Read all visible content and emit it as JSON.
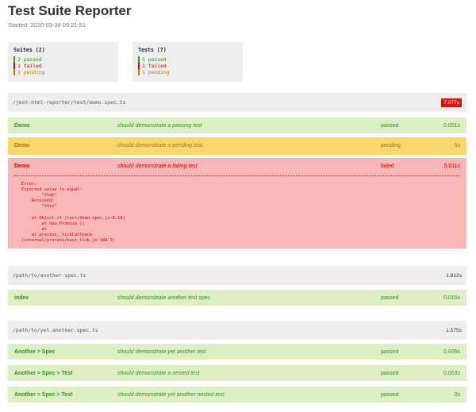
{
  "title": "Test Suite Reporter",
  "started": "Started: 2020-03-30 09:21:51",
  "summary": {
    "suites": {
      "title": "Suites (2)",
      "passed": "2 passed",
      "failed": "1 failed",
      "pending": "1 pending"
    },
    "tests": {
      "title": "Tests (7)",
      "passed": "5 passed",
      "failed": "1 failed",
      "pending": "1 pending"
    }
  },
  "colors": {
    "passed": "#3a8e1e",
    "failed": "#cc0000",
    "pending": "#c07a00",
    "slow_badge": "#d9150a"
  },
  "suites": [
    {
      "path": "/jest-html-reporter/test/demo.spec.ts",
      "time": "7.077s",
      "tests": [
        {
          "title": "Demo",
          "name": "should demonstrate a passing test",
          "status": "passed",
          "time": "0.001s"
        },
        {
          "title": "Demo",
          "name": "should demonstrate a pending test",
          "status": "pending",
          "time": "5s"
        },
        {
          "title": "Demo",
          "name": "should demonstrate a failing test",
          "status": "failed",
          "time": "5.011s",
          "failure": "Error:\nExpected value to equal:\n        \"that\"\n    Received:\n        \"this\"\n\n    at Object.it (test/demo.spec.js:6:16)\n        at new Promise ()\n        at\n    at process._tickCallback\n(internal/process/next_tick.js:188:7)"
        }
      ]
    },
    {
      "path": "/path/to/another-spec.ts",
      "time": "1.812s",
      "tests": [
        {
          "title": "index",
          "name": "should demonstrate another test spec",
          "status": "passed",
          "time": "0.015s"
        }
      ]
    },
    {
      "path": "/path/to/yet.another.spec.ts",
      "time": "1.575s",
      "tests": [
        {
          "title": "Another > Spec",
          "name": "should demonstrate yet another test",
          "status": "passed",
          "time": "0.005s"
        },
        {
          "title": "Another > Spec > Test",
          "name": "should demonstrate a nested test",
          "status": "passed",
          "time": "0.003s"
        },
        {
          "title": "Another > Spec > Test",
          "name": "should demonstrate yet another nested test",
          "status": "passed",
          "time": "0s"
        }
      ]
    }
  ]
}
